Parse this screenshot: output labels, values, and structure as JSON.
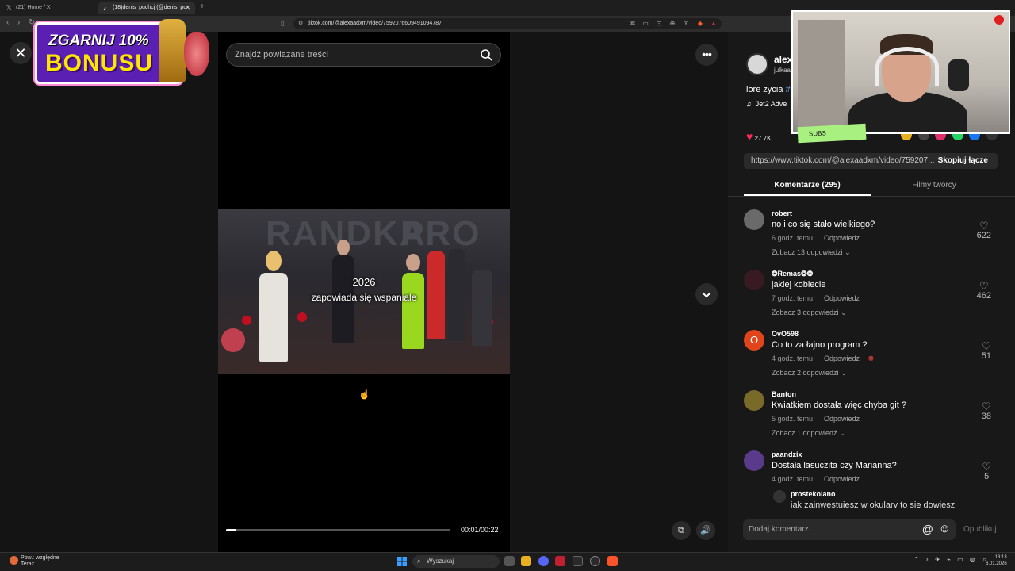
{
  "browser": {
    "tabs": [
      {
        "label": "(21) Home / X",
        "icon": "x-icon",
        "active": false
      },
      {
        "label": "(18)denis_puchcj (@denis_pu",
        "icon": "tiktok-icon",
        "active": true
      }
    ],
    "new_tab": "+",
    "url": "tiktok.com/@alexaadxm/video/7592076609491094787"
  },
  "promo": {
    "line1": "ZGARNIJ 10%",
    "line2": "BONUSU"
  },
  "search": {
    "placeholder": "Znajdź powiązane treści"
  },
  "video": {
    "caption_year": "2026",
    "caption_text": "zapowiada się wspaniale",
    "time": "00:01/00:22",
    "progress_fraction": 0.045
  },
  "author": {
    "name": "alex",
    "sub": "julkaa",
    "description_prefix": "lore zycia ",
    "description_tag": "#",
    "music": "Jet2 Adve",
    "likes": "27.7K"
  },
  "link": {
    "url": "https://www.tiktok.com/@alexaadxm/video/759207...",
    "copy_label": "Skopiuj łącze"
  },
  "tabs": {
    "comments": "Komentarze (295)",
    "films": "Filmy twórcy"
  },
  "comments": [
    {
      "user": "robert",
      "text": "no i co się stało wielkiego?",
      "time": "6 godz. temu",
      "reply": "Odpowiedz",
      "more": "Zobacz 13 odpowiedzi",
      "likes": "622",
      "avatar_color": "#6a6a6a"
    },
    {
      "user": "❂Remas❂❂",
      "text": "jakiej kobiecie",
      "time": "7 godz. temu",
      "reply": "Odpowiedz",
      "more": "Zobacz 3 odpowiedzi",
      "likes": "462",
      "avatar_color": "#3a1a22"
    },
    {
      "user": "OvO598",
      "text": "Co to za łajno program ?",
      "time": "4 godz. temu",
      "reply": "Odpowiedz",
      "more": "Zobacz 2 odpowiedzi",
      "likes": "51",
      "avatar_color": "#e0441a",
      "avatar_letter": "O"
    },
    {
      "user": "Banton",
      "text": "Kwiatkiem dostała więc chyba git ?",
      "time": "5 godz. temu",
      "reply": "Odpowiedz",
      "more": "Zobacz 1 odpowiedź",
      "likes": "38",
      "avatar_color": "#7a6a2a"
    },
    {
      "user": "paandzix",
      "text": "Dostała lasuczita czy Marianna?",
      "time": "4 godz. temu",
      "reply": "Odpowiedz",
      "more": "",
      "likes": "5",
      "avatar_color": "#5a3a8a"
    }
  ],
  "subreply": {
    "user": "prostekolano",
    "text": "jak zainwestujesz w okulary to się dowiesz"
  },
  "comment_input": {
    "placeholder": "Dodaj komentarz...",
    "publish": "Opublikuj"
  },
  "webcam": {
    "subs_label": "SUBS"
  },
  "taskbar": {
    "weather_title": "Pow.: względne",
    "weather_sub": "Teraz",
    "search": "Wyszukaj",
    "time": "13:13",
    "date": "6.01.2026"
  },
  "colors": {
    "accent": "#fe2c55",
    "background": "#121212",
    "promo": "#5b1fb4",
    "promo_text": "#ffe600"
  }
}
